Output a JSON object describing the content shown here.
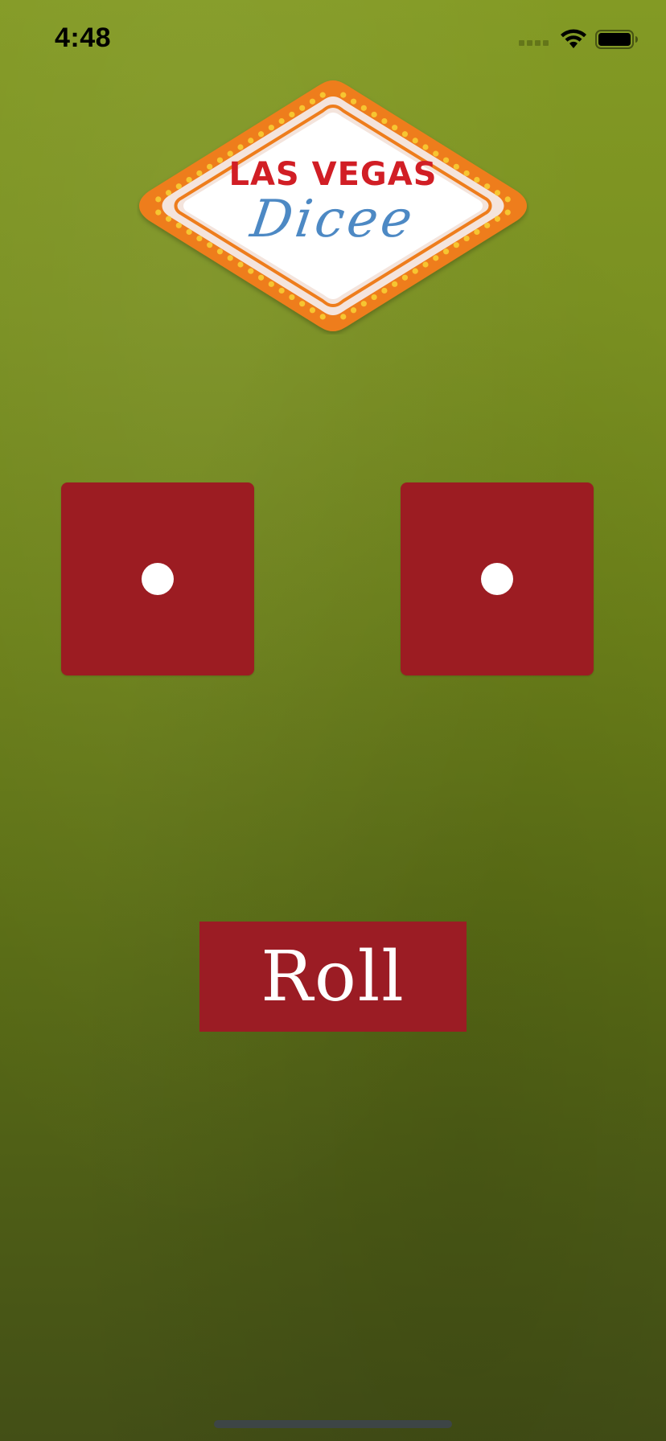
{
  "status_bar": {
    "time": "4:48",
    "signal_icon": "cellular-signal-icon",
    "wifi_icon": "wifi-icon",
    "battery_icon": "battery-icon"
  },
  "logo": {
    "title": "LAS VEGAS",
    "script": "Dicee",
    "colors": {
      "border": "#ee7d1c",
      "bulbs": "#f7c531",
      "title": "#d11e25",
      "script": "#4d89c4"
    }
  },
  "dice": [
    {
      "name": "left-die",
      "face": 1,
      "color": "#9c1c22"
    },
    {
      "name": "right-die",
      "face": 1,
      "color": "#9c1c22"
    }
  ],
  "roll_button": {
    "label": "Roll",
    "color": "#9b1c24"
  },
  "background": {
    "top": "#839a24",
    "bottom": "#434f16"
  }
}
